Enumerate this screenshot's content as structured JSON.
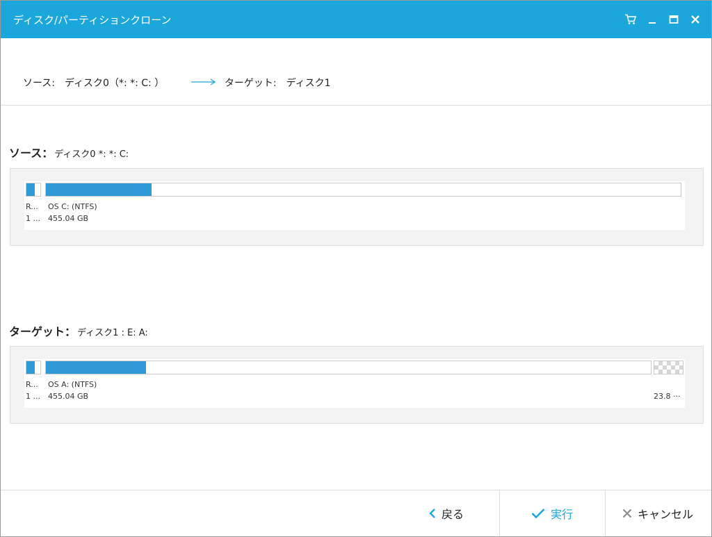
{
  "window": {
    "title": "ディスク/パーティションクローン",
    "accent": "#1ba7dc",
    "controls": [
      "cart-icon",
      "minimize-icon",
      "maximize-icon",
      "close-icon"
    ]
  },
  "route": {
    "source": "ソース:　ディスク0（*: *: C: ）",
    "target": "ターゲット:　ディスク1"
  },
  "source_section": {
    "label_bold": "ソース：",
    "label_rest": "ディスク0 *: *: C:",
    "partitions": [
      {
        "line1": "R...",
        "line2": "1 ...",
        "fill": 0.6
      },
      {
        "line1": "OS C: (NTFS)",
        "line2": "455.04 GB",
        "fill": 0.166
      }
    ]
  },
  "target_section": {
    "label_bold": "ターゲット：",
    "label_rest": "ディスク1 : E: A:",
    "partitions": [
      {
        "line1": "R...",
        "line2": "1 ...",
        "fill": 0.6
      },
      {
        "line1": "OS A: (NTFS)",
        "line2": "455.04 GB",
        "fill": 0.166
      },
      {
        "line1": "",
        "line2": "23.8 ···",
        "unallocated": true
      }
    ]
  },
  "footer": {
    "back_label": "戻る",
    "execute_label": "実行",
    "cancel_label": "キャンセル",
    "colors": {
      "primary": "#1ba7dc",
      "cancel_icon": "#8c8c8c"
    }
  }
}
